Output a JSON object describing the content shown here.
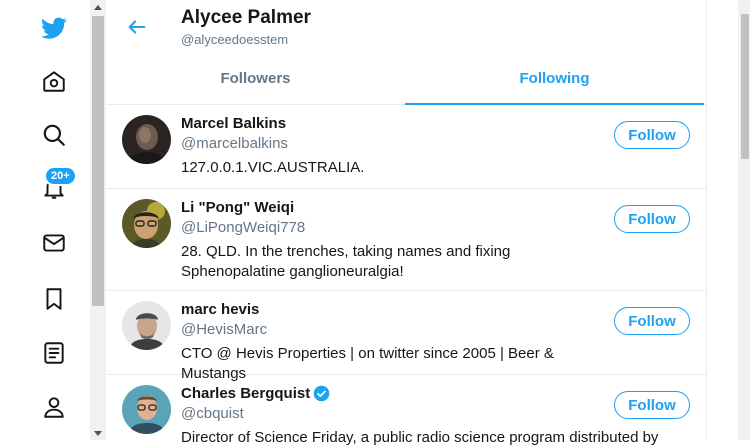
{
  "nav": {
    "items": [
      "twitter-logo",
      "home",
      "explore",
      "notifications",
      "messages",
      "bookmarks",
      "lists",
      "profile"
    ],
    "notifications_badge": "20+"
  },
  "colors": {
    "accent": "#1da1f2",
    "text": "#14171a",
    "secondary": "#657786",
    "border": "#e6ecf0"
  },
  "header": {
    "title": "Alycee Palmer",
    "handle": "@alyceedoesstem"
  },
  "tabs": [
    {
      "label": "Followers",
      "active": false
    },
    {
      "label": "Following",
      "active": true
    }
  ],
  "users": [
    {
      "name": "Marcel Balkins",
      "handle": "@marcelbalkins",
      "bio": "127.0.0.1.VIC.AUSTRALIA.",
      "button": "Follow",
      "verified": false
    },
    {
      "name": "Li \"Pong\" Weiqi",
      "handle": "@LiPongWeiqi778",
      "bio": "28. QLD. In the trenches, taking names and fixing Sphenopalatine ganglioneuralgia!",
      "button": "Follow",
      "verified": false
    },
    {
      "name": "marc hevis",
      "handle": "@HevisMarc",
      "bio": "CTO @ Hevis Properties | on twitter since 2005 | Beer & Mustangs",
      "button": "Follow",
      "verified": false
    },
    {
      "name": "Charles Bergquist",
      "handle": "@cbquist",
      "bio": "Director of Science Friday, a public radio science program distributed by",
      "button": "Follow",
      "verified": true
    }
  ]
}
